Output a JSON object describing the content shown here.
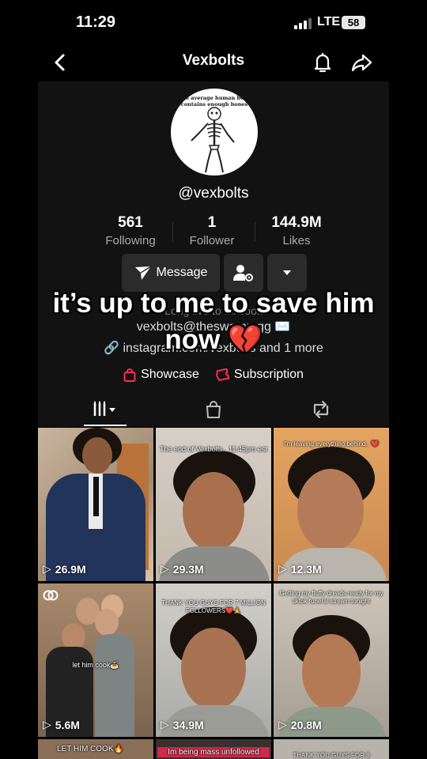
{
  "status": {
    "time": "11:29",
    "network": "LTE",
    "battery": "58"
  },
  "nav": {
    "title": "Vexbolts",
    "back_icon": "chevron-left-icon",
    "bell_icon": "bell-icon",
    "share_icon": "share-icon"
  },
  "profile": {
    "avatar_text": "The average human body contains enough bones",
    "handle": "@vexbolts",
    "stats": [
      {
        "value": "561",
        "label": "Following"
      },
      {
        "value": "1",
        "label": "Follower"
      },
      {
        "value": "144.9M",
        "label": "Likes"
      }
    ],
    "message_label": "Message",
    "bio_faded": "Long live to mi cook",
    "email": "vexbolts@theswamp.gg",
    "link_text": "instagram.com/vexbolts",
    "link_more": "and 1 more",
    "showcase_label": "Showcase",
    "subscription_label": "Subscription",
    "colors": {
      "accent": "#fe2c55",
      "panel": "#121212",
      "button": "#2b2b2b"
    }
  },
  "overlay": {
    "line1": "it’s up to me to save him",
    "line2": "now 💔"
  },
  "videos": [
    {
      "views": "26.9M",
      "caption": ""
    },
    {
      "views": "29.3M",
      "caption": "The end of Vexbolts.. 11:45pm est"
    },
    {
      "views": "12.3M",
      "caption": "I'm leaving everything behind.. ❤️"
    },
    {
      "views": "5.6M",
      "caption": "let him cook🍝"
    },
    {
      "views": "34.9M",
      "caption": "THANK YOU GUYS FOR 7 MILLION FOLLOWERS❤️🙏"
    },
    {
      "views": "20.8M",
      "caption": "Getting my fluffy dreads ready for my tiktok funeral stream tonight"
    },
    {
      "views": "",
      "caption": "LET HIM COOK🔥"
    },
    {
      "views": "",
      "caption": "Im being mass unfollowed"
    },
    {
      "views": "",
      "caption": "THANK YOU GUYS FOR 8"
    }
  ]
}
